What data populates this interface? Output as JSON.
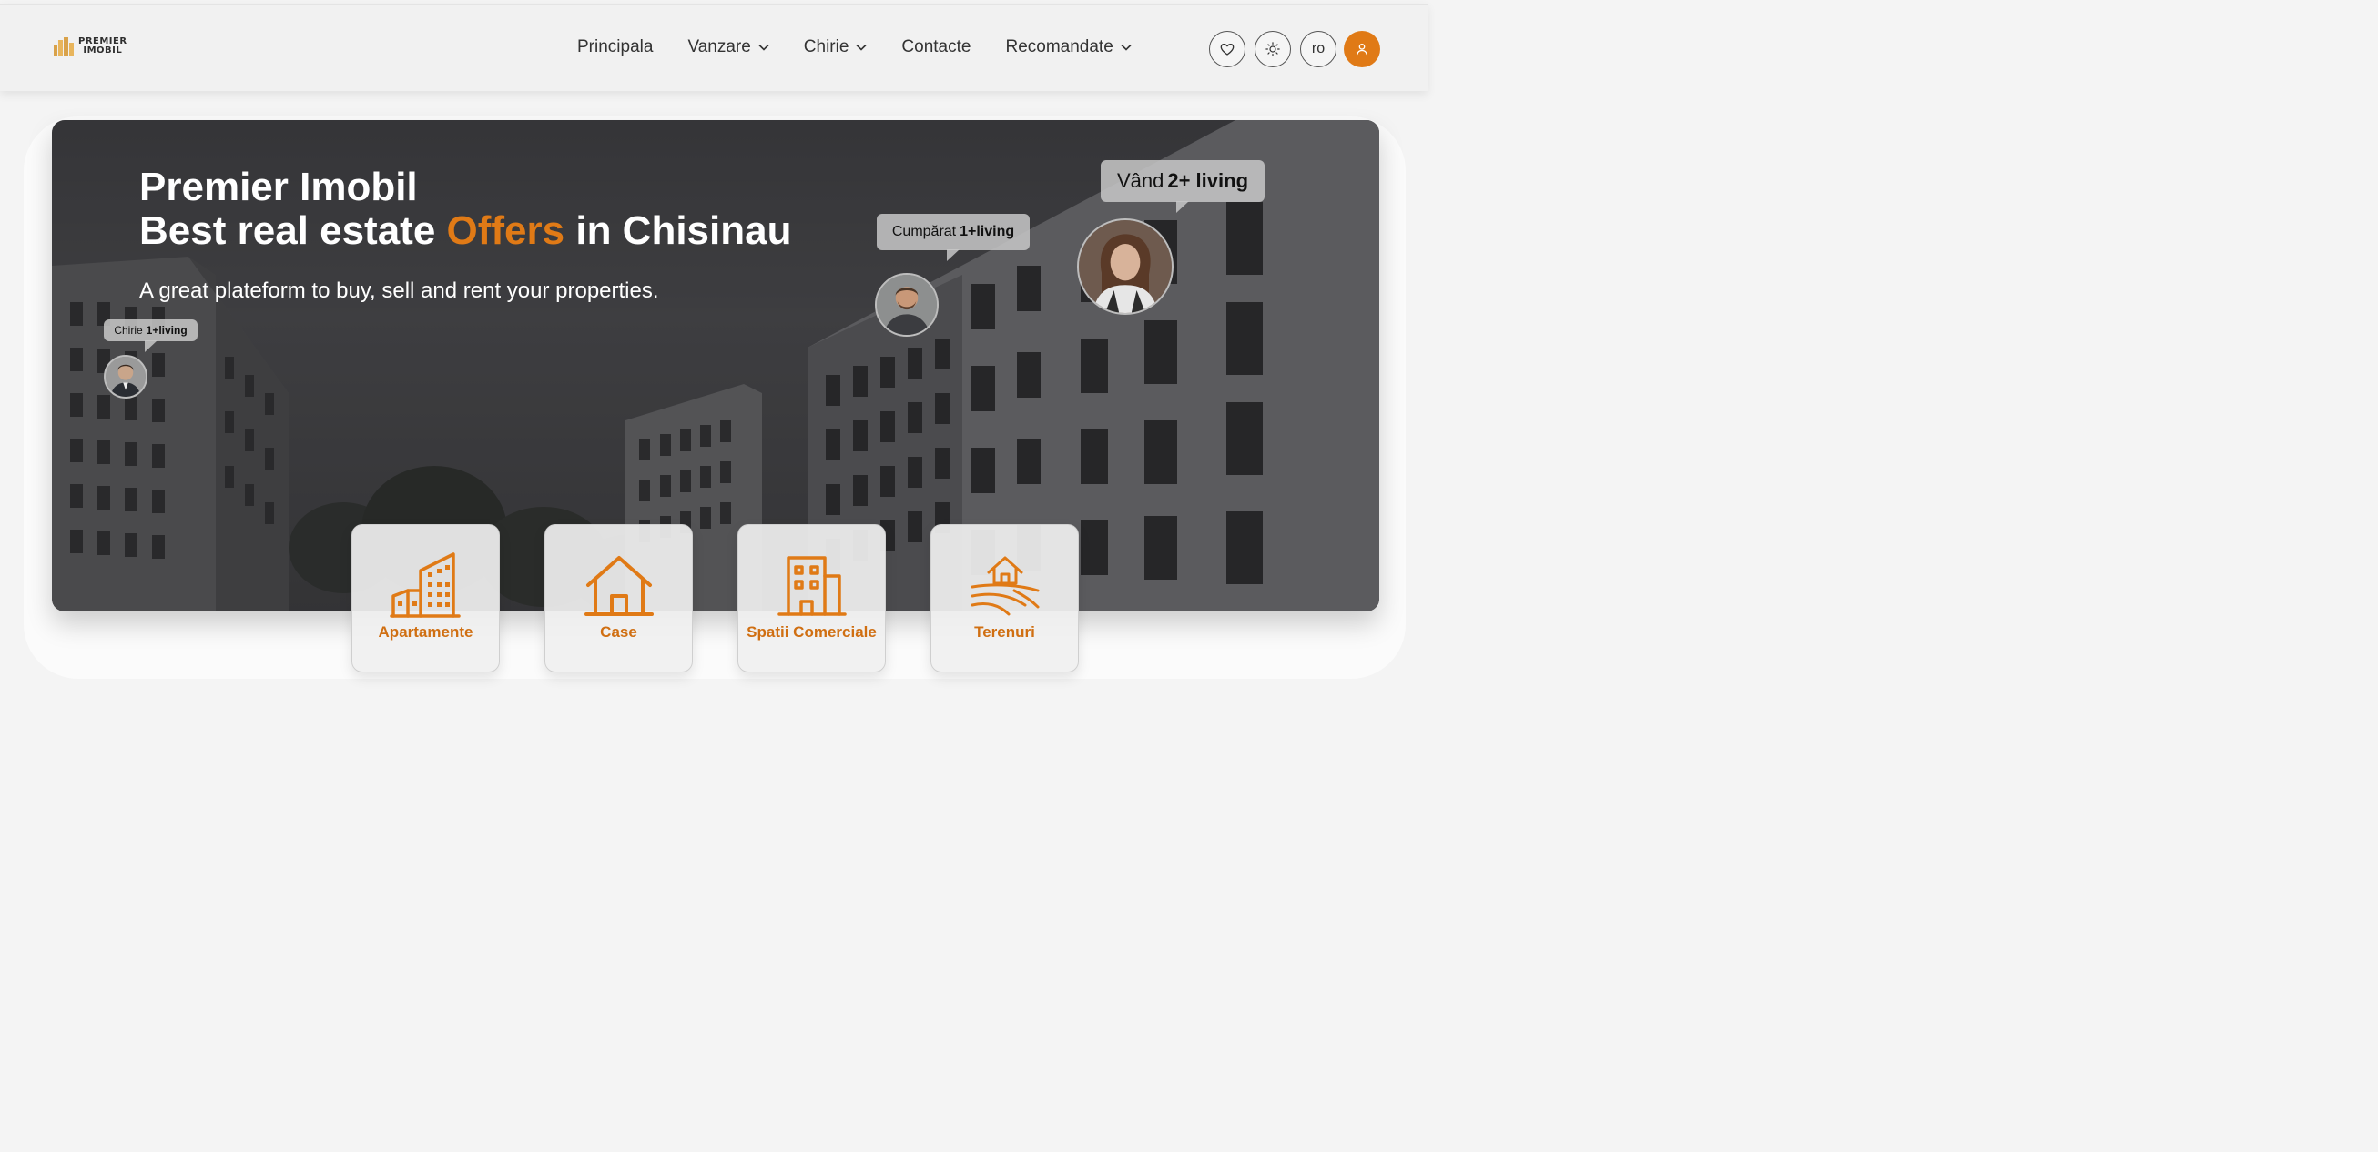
{
  "header": {
    "logo": {
      "line1": "PREMIER",
      "line2": "IMOBIL"
    },
    "nav": [
      {
        "label": "Principala",
        "dropdown": false
      },
      {
        "label": "Vanzare",
        "dropdown": true
      },
      {
        "label": "Chirie",
        "dropdown": true
      },
      {
        "label": "Contacte",
        "dropdown": false
      },
      {
        "label": "Recomandate",
        "dropdown": true
      }
    ],
    "actions": {
      "favorites_icon": "heart-icon",
      "theme_icon": "sun-icon",
      "language": "ro",
      "account_icon": "user-icon"
    }
  },
  "hero": {
    "title_line1": "Premier Imobil",
    "title_line2_before": "Best real estate ",
    "title_line2_accent": "Offers",
    "title_line2_after": " in Chisinau",
    "subtitle": "A great plateform to buy, sell and rent your properties.",
    "bubbles": [
      {
        "text": "Chirie",
        "bold": "1+living"
      },
      {
        "text": "Cumpărat",
        "bold": "1+living"
      },
      {
        "text": "Vând",
        "bold": "2+ living"
      }
    ]
  },
  "categories": [
    {
      "label": "Apartamente",
      "icon": "apartment-building-icon"
    },
    {
      "label": "Case",
      "icon": "house-icon"
    },
    {
      "label": "Spatii Comerciale",
      "icon": "commercial-building-icon"
    },
    {
      "label": "Terenuri",
      "icon": "land-icon"
    }
  ],
  "colors": {
    "accent": "#e07a16",
    "header_bg": "#f1f1f1",
    "hero_overlay": "#3c3c3f",
    "category_label": "#d06f12"
  }
}
